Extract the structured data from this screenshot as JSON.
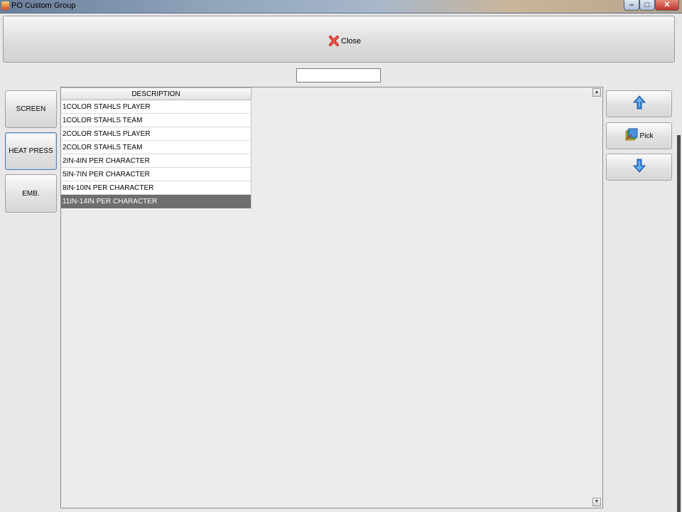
{
  "window": {
    "title": "PO Custom Group",
    "controls": {
      "minimize": "–",
      "maximize": "□",
      "close": "✕"
    }
  },
  "toolbar": {
    "close_label": "Close"
  },
  "search": {
    "value": ""
  },
  "categories": [
    {
      "label": "SCREEN"
    },
    {
      "label": "HEAT PRESS",
      "active": true
    },
    {
      "label": "EMB."
    }
  ],
  "grid": {
    "header": "DESCRIPTION",
    "rows": [
      "1COLOR STAHLS PLAYER",
      "1COLOR STAHLS TEAM",
      "2COLOR STAHLS PLAYER",
      "2COLOR STAHLS TEAM",
      "2IN-4IN PER CHARACTER",
      "5IN-7IN PER CHARACTER",
      "8IN-10IN PER CHARACTER",
      "11IN-14IN PER CHARACTER"
    ],
    "selected_index": 7
  },
  "actions": {
    "up": "up-arrow-icon",
    "pick_label": "Pick",
    "down": "down-arrow-icon"
  },
  "colors": {
    "selected_row": "#6e6e6e",
    "arrow_blue": "#2f7fd8",
    "close_red": "#d9332b"
  }
}
